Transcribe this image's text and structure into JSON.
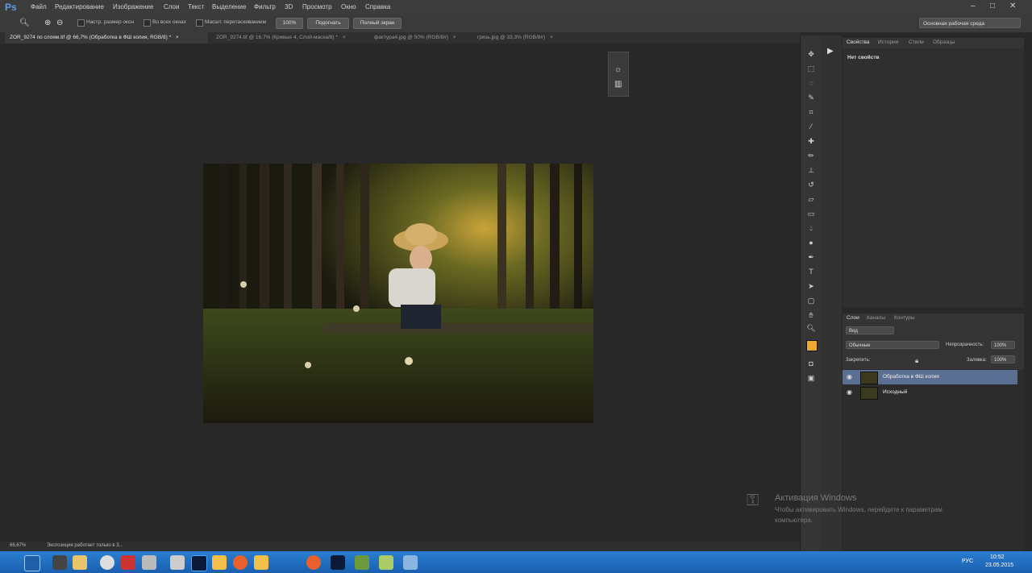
{
  "app": {
    "logo": "Ps"
  },
  "menu": [
    "Файл",
    "Редактирование",
    "Изображение",
    "Слои",
    "Текст",
    "Выделение",
    "Фильтр",
    "3D",
    "Просмотр",
    "Окно",
    "Справка"
  ],
  "window_controls": {
    "minimize": "–",
    "maximize": "□",
    "close": "✕"
  },
  "options": {
    "chk1": "Настр. размер окон",
    "chk2": "Во всех окнах",
    "chk3": "Масшт. перетаскиванием",
    "zoom_value": "100%",
    "fit_btn": "Подогнать",
    "full_btn": "Полный экран",
    "workspace": "Основная рабочая среда"
  },
  "tabs": [
    "ZOR_9274 по слоям.tif @ 66,7% (Обработка в ФШ копия, RGB/8) *",
    "ZOR_9274.tif @ 16,7% (Кривые 4, Слой-маска/8) *",
    "фактура4.jpg @ 50% (RGB/8#)",
    "грязь.jpg @ 33,3% (RGB/8#)"
  ],
  "tab_close": "×",
  "status": {
    "zoom": "66,67%",
    "message": "Экспозиция работает только в 3..."
  },
  "panels": {
    "props_tabs": [
      "Свойства",
      "Истории",
      "Стили",
      "Образцы"
    ],
    "props_text": "Нет свойств",
    "layers_tabs": [
      "Слои",
      "Каналы",
      "Контуры"
    ],
    "filter": "Вид",
    "blend": "Обычные",
    "opacity_label": "Непрозрачность:",
    "opacity_value": "100%",
    "lock_label": "Закрепить:",
    "fill_label": "Заливка:",
    "fill_value": "100%",
    "layers": [
      "Обработка в ФШ копия",
      "Исходный"
    ]
  },
  "activation": {
    "title": "Активация Windows",
    "line1": "Чтобы активировать Windows, перейдите к параметрам",
    "line2": "компьютера."
  },
  "tray": {
    "lang": "РУС",
    "time": "10:52",
    "date": "23.05.2015"
  },
  "colors": {
    "foreground": "#f0a830",
    "background": "#000000",
    "accent": "#5aa0e6"
  }
}
